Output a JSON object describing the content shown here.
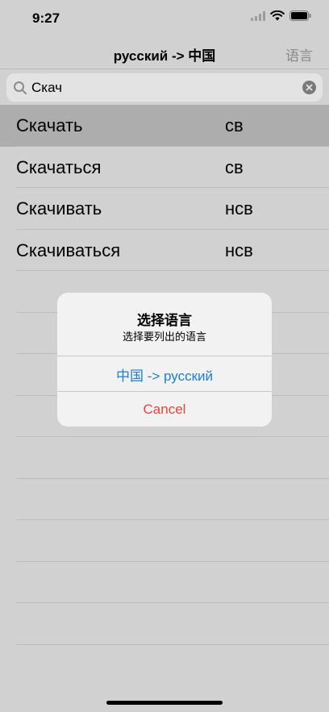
{
  "status_bar": {
    "time": "9:27"
  },
  "nav": {
    "title": "русский -> 中国",
    "right_button": "语言"
  },
  "search": {
    "value": "Скач"
  },
  "results": [
    {
      "word": "Скачать",
      "aspect": "св",
      "selected": true
    },
    {
      "word": "Скачаться",
      "aspect": "св",
      "selected": false
    },
    {
      "word": "Скачивать",
      "aspect": "нсв",
      "selected": false
    },
    {
      "word": "Скачиваться",
      "aspect": "нсв",
      "selected": false
    }
  ],
  "alert": {
    "title": "选择语言",
    "message": "选择要列出的语言",
    "option": "中国 -> русский",
    "cancel": "Cancel"
  },
  "colors": {
    "accent": "#1a7fd6",
    "destructive": "#e2463c",
    "dim_background": "#d1d1d1",
    "selected_row": "#adadad"
  }
}
